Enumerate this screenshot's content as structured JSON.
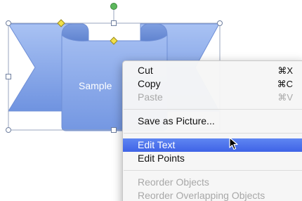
{
  "canvas": {
    "shape_text": "Sample"
  },
  "context_menu": {
    "groups": [
      [
        {
          "label": "Cut",
          "shortcut": "⌘X",
          "enabled": true
        },
        {
          "label": "Copy",
          "shortcut": "⌘C",
          "enabled": true
        },
        {
          "label": "Paste",
          "shortcut": "⌘V",
          "enabled": false
        }
      ],
      [
        {
          "label": "Save as Picture...",
          "shortcut": "",
          "enabled": true
        }
      ],
      [
        {
          "label": "Edit Text",
          "shortcut": "",
          "enabled": true,
          "highlighted": true
        },
        {
          "label": "Edit Points",
          "shortcut": "",
          "enabled": true
        }
      ],
      [
        {
          "label": "Reorder Objects",
          "shortcut": "",
          "enabled": false
        },
        {
          "label": "Reorder Overlapping Objects",
          "shortcut": "",
          "enabled": false
        }
      ]
    ]
  },
  "colors": {
    "shape_fill_light": "#a7c0f2",
    "shape_fill_dark": "#7a9be3",
    "shape_edge": "#6f8fd6",
    "handle_adjust": "#f1e04a",
    "handle_rotate": "#5cb85c",
    "menu_highlight": "#4a6ef0"
  },
  "icons": {
    "pointer": "arrow-cursor-icon"
  }
}
